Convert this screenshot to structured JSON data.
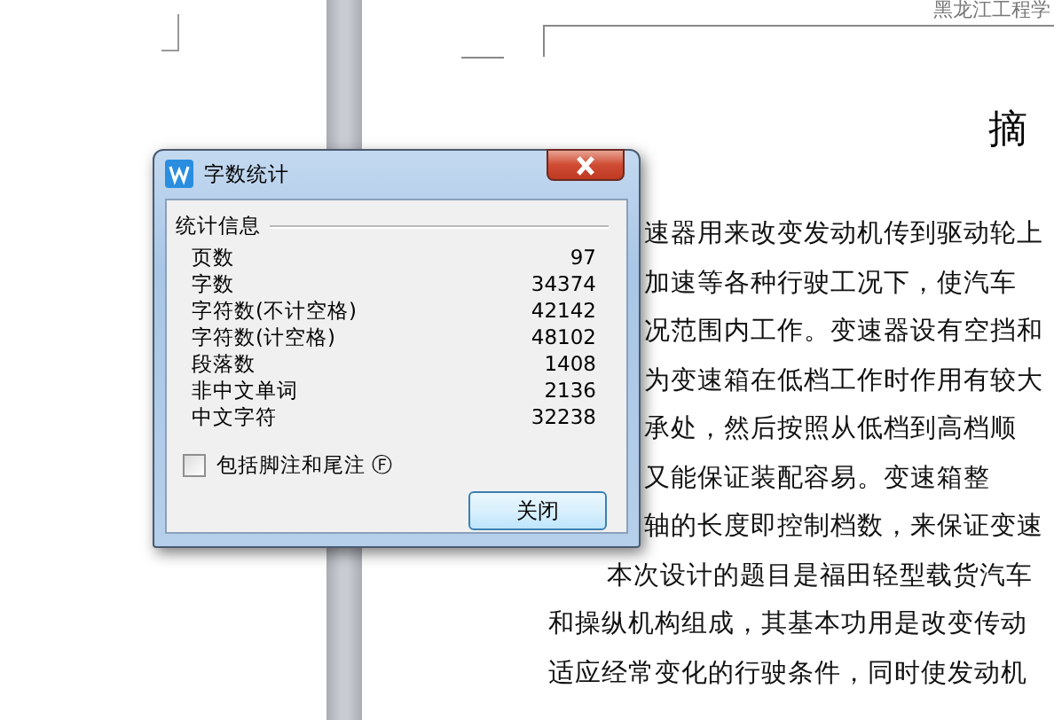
{
  "document": {
    "header": "黑龙江工程学",
    "heading": "摘",
    "lines": [
      {
        "kind": "covered",
        "text": "速器用来改变发动机传到驱动轮上"
      },
      {
        "kind": "covered",
        "text": "加速等各种行驶工况下，使汽车"
      },
      {
        "kind": "covered",
        "text": "况范围内工作。变速器设有空挡和"
      },
      {
        "kind": "covered",
        "text": "为变速箱在低档工作时作用有较大"
      },
      {
        "kind": "covered",
        "text": "承处，然后按照从低档到高档顺"
      },
      {
        "kind": "covered",
        "text": "又能保证装配容易。变速箱整"
      },
      {
        "kind": "covered",
        "text": "轴的长度即控制档数，来保证变速"
      },
      {
        "kind": "first",
        "text": "本次设计的题目是福田轻型载货汽车"
      },
      {
        "kind": "body",
        "text": "和操纵机构组成，其基本功用是改变传动"
      },
      {
        "kind": "body",
        "text": "适应经常变化的行驶条件，同时使发动机"
      }
    ]
  },
  "dialog": {
    "title": "字数统计",
    "group": "统计信息",
    "stats": [
      {
        "label": "页数",
        "value": "97"
      },
      {
        "label": "字数",
        "value": "34374"
      },
      {
        "label": "字符数(不计空格)",
        "value": "42142"
      },
      {
        "label": "字符数(计空格)",
        "value": "48102"
      },
      {
        "label": "段落数",
        "value": "1408"
      },
      {
        "label": "非中文单词",
        "value": "2136"
      },
      {
        "label": "中文字符",
        "value": "32238"
      }
    ],
    "option": {
      "label": "包括脚注和尾注",
      "shortcut": "Ⓕ",
      "checked": false
    },
    "buttons": [
      "关闭"
    ]
  }
}
